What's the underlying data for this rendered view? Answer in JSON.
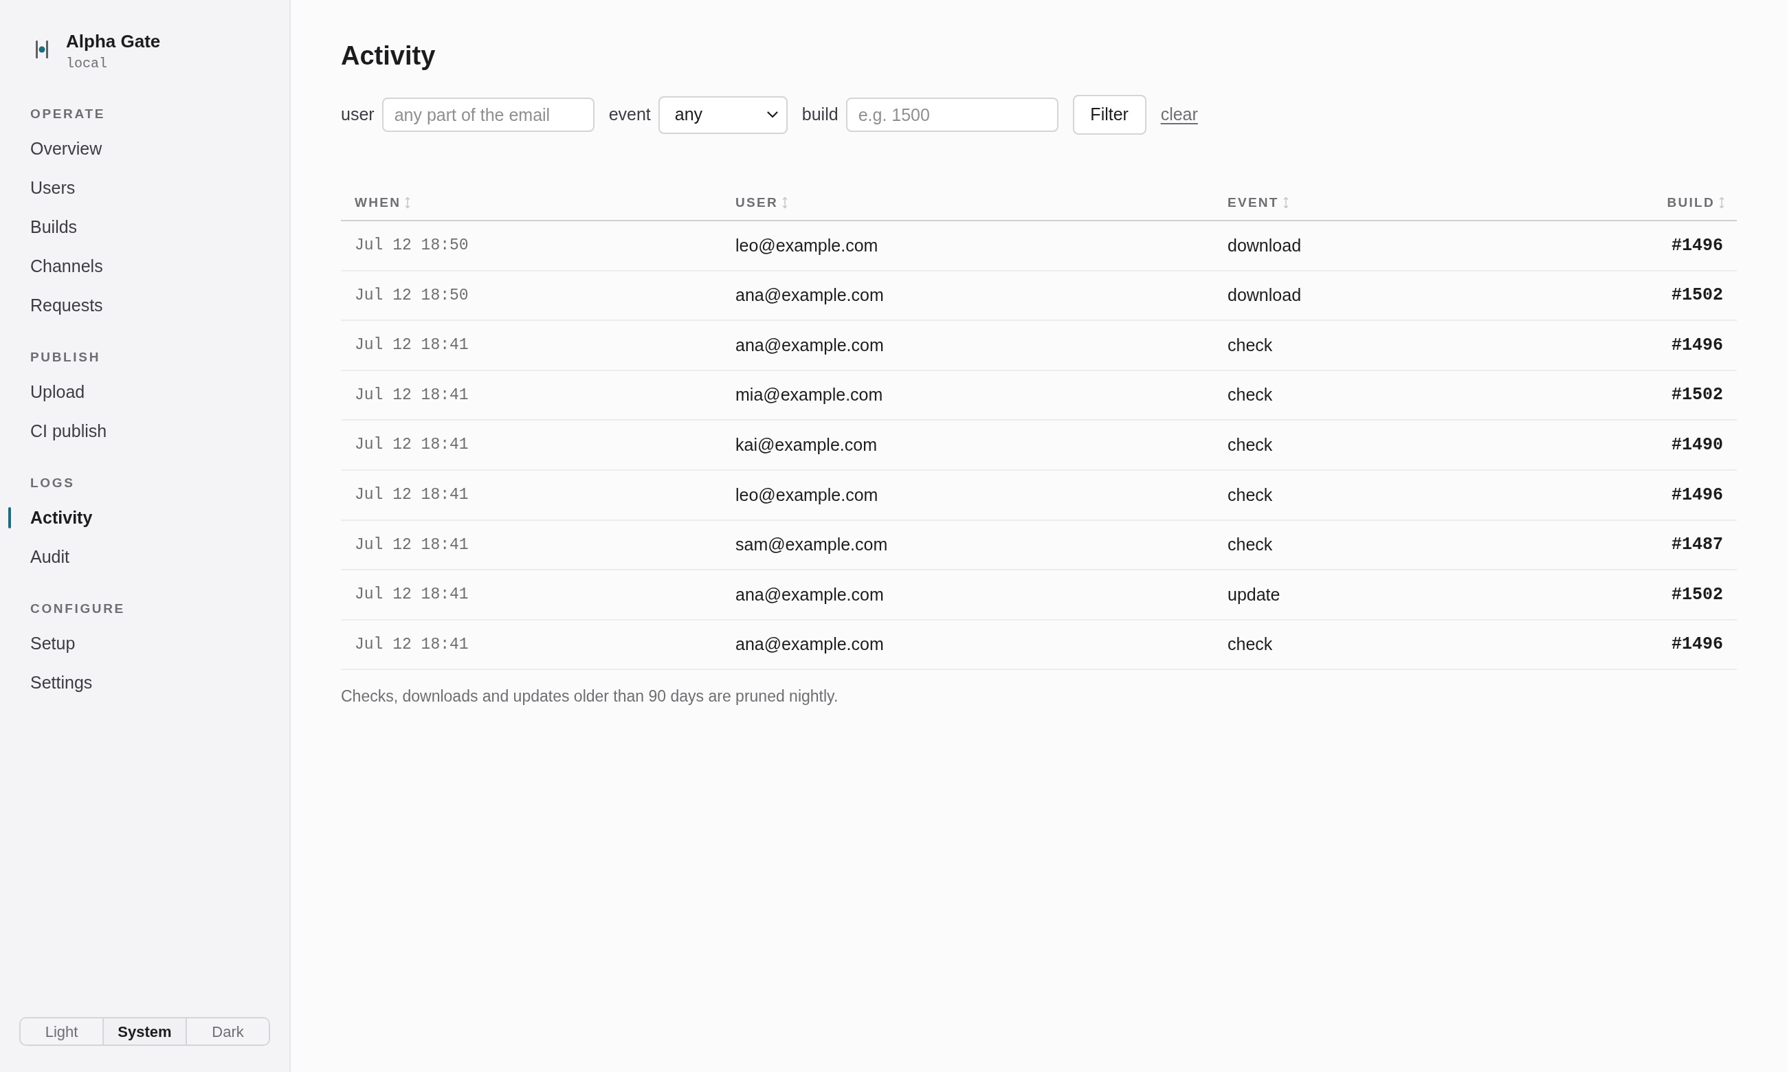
{
  "sidebar": {
    "brand": {
      "name": "Alpha Gate",
      "env": "local"
    },
    "sections": [
      {
        "heading": "OPERATE",
        "items": [
          {
            "label": "Overview",
            "selected": false
          },
          {
            "label": "Users",
            "selected": false
          },
          {
            "label": "Builds",
            "selected": false
          },
          {
            "label": "Channels",
            "selected": false
          },
          {
            "label": "Requests",
            "selected": false
          }
        ]
      },
      {
        "heading": "PUBLISH",
        "items": [
          {
            "label": "Upload",
            "selected": false
          },
          {
            "label": "CI publish",
            "selected": false
          }
        ]
      },
      {
        "heading": "LOGS",
        "items": [
          {
            "label": "Activity",
            "selected": true
          },
          {
            "label": "Audit",
            "selected": false
          }
        ]
      },
      {
        "heading": "CONFIGURE",
        "items": [
          {
            "label": "Setup",
            "selected": false
          },
          {
            "label": "Settings",
            "selected": false
          }
        ]
      }
    ],
    "theme_toggle": [
      {
        "label": "Light",
        "selected": false
      },
      {
        "label": "System",
        "selected": true
      },
      {
        "label": "Dark",
        "selected": false
      }
    ]
  },
  "page": {
    "title": "Activity"
  },
  "filters": {
    "user": {
      "label": "user",
      "placeholder": "any part of the email"
    },
    "event": {
      "label": "event",
      "value": "any"
    },
    "build": {
      "label": "build",
      "placeholder": "e.g. 1500"
    },
    "submit": "Filter",
    "clear": "clear"
  },
  "table": {
    "columns": [
      "WHEN",
      "USER",
      "EVENT",
      "BUILD"
    ],
    "rows": [
      {
        "when": "Jul 12 18:50",
        "user": "leo@example.com",
        "event": "download",
        "build": "#1496"
      },
      {
        "when": "Jul 12 18:50",
        "user": "ana@example.com",
        "event": "download",
        "build": "#1502"
      },
      {
        "when": "Jul 12 18:41",
        "user": "ana@example.com",
        "event": "check",
        "build": "#1496"
      },
      {
        "when": "Jul 12 18:41",
        "user": "mia@example.com",
        "event": "check",
        "build": "#1502"
      },
      {
        "when": "Jul 12 18:41",
        "user": "kai@example.com",
        "event": "check",
        "build": "#1490"
      },
      {
        "when": "Jul 12 18:41",
        "user": "leo@example.com",
        "event": "check",
        "build": "#1496"
      },
      {
        "when": "Jul 12 18:41",
        "user": "sam@example.com",
        "event": "check",
        "build": "#1487"
      },
      {
        "when": "Jul 12 18:41",
        "user": "ana@example.com",
        "event": "update",
        "build": "#1502"
      },
      {
        "when": "Jul 12 18:41",
        "user": "ana@example.com",
        "event": "check",
        "build": "#1496"
      }
    ]
  },
  "note": "Checks, downloads and updates older than 90 days are pruned nightly."
}
